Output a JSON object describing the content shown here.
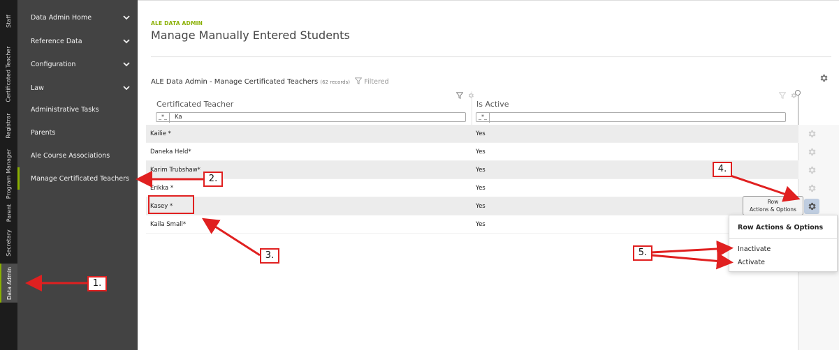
{
  "vertical_tabs": [
    {
      "label": "Staff",
      "active": false
    },
    {
      "label": "Certificated Teacher",
      "active": false
    },
    {
      "label": "Registrar",
      "active": false
    },
    {
      "label": "Program Manager",
      "active": false
    },
    {
      "label": "Parent",
      "active": false
    },
    {
      "label": "Secretary",
      "active": false
    },
    {
      "label": "Data Admin",
      "active": true
    }
  ],
  "sidebar": {
    "items": [
      {
        "label": "Data Admin Home",
        "has_chevron": true
      },
      {
        "label": "Reference Data",
        "has_chevron": true
      },
      {
        "label": "Configuration",
        "has_chevron": true
      },
      {
        "label": "Law",
        "has_chevron": true
      },
      {
        "label": "Administrative Tasks",
        "has_chevron": false
      },
      {
        "label": "Parents",
        "has_chevron": false
      },
      {
        "label": "Ale Course Associations",
        "has_chevron": false
      },
      {
        "label": "Manage Certificated Teachers",
        "has_chevron": false,
        "active": true
      }
    ]
  },
  "header": {
    "eyebrow": "ALE DATA ADMIN",
    "title": "Manage Manually Entered Students"
  },
  "grid": {
    "title": "ALE Data Admin - Manage Certificated Teachers",
    "record_count": "(62 records)",
    "filtered_label": "Filtered",
    "columns": [
      {
        "label": "Certificated Teacher",
        "filter_tag": "_*_",
        "filter_value": "Ka"
      },
      {
        "label": "Is Active",
        "filter_tag": "_*_",
        "filter_value": ""
      }
    ],
    "rows": [
      {
        "teacher": "Kailie *",
        "active": "Yes"
      },
      {
        "teacher": "Daneka Held*",
        "active": "Yes"
      },
      {
        "teacher": "Karim Trubshaw*",
        "active": "Yes"
      },
      {
        "teacher": "Erikka *",
        "active": "Yes"
      },
      {
        "teacher": "Kasey *",
        "active": "Yes"
      },
      {
        "teacher": "Kaila Small*",
        "active": "Yes"
      }
    ]
  },
  "tooltip": {
    "line1": "Row",
    "line2": "Actions & Options"
  },
  "row_menu": {
    "title": "Row Actions & Options",
    "items": [
      "Inactivate",
      "Activate"
    ]
  },
  "annotations": {
    "callouts": [
      "1.",
      "2.",
      "3.",
      "4.",
      "5."
    ]
  },
  "colors": {
    "accent": "#8ab000",
    "annotation": "#e02020",
    "sidebar_bg": "#434343",
    "tabbar_bg": "#1c1c1c"
  }
}
